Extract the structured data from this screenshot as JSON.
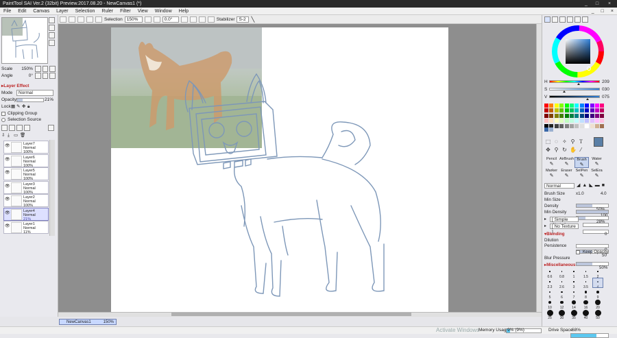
{
  "title": "PaintTool SAI Ver.2 (32bit) Preview.2017.08.20 - NewCanvas1 (*)",
  "window_buttons": [
    "_",
    "□",
    "×"
  ],
  "menu": [
    "File",
    "Edit",
    "Canvas",
    "Layer",
    "Selection",
    "Ruler",
    "Filter",
    "View",
    "Window",
    "Help"
  ],
  "menu_right": [
    "_",
    "□",
    "×"
  ],
  "toolbar": {
    "selection_label": "Selection",
    "zoom": "150%",
    "angle": "0.0°",
    "stabilizer_label": "Stabilizer",
    "stabilizer_value": "S-2"
  },
  "navigator": {
    "scale_label": "Scale",
    "scale_value": "150%",
    "angle_label": "Angle",
    "angle_value": "0°"
  },
  "layer_panel": {
    "layer_effect": "Layer Effect",
    "mode_label": "Mode",
    "mode_value": "Normal",
    "opacity_label": "Opacity",
    "opacity_value": "21%",
    "opacity_level": 0.21,
    "lock_label": "Lock",
    "clipping_group": "Clipping Group",
    "selection_source": "Selection Source",
    "layers": [
      {
        "name": "Layer7",
        "mode": "Normal",
        "opacity": "100%",
        "selected": false
      },
      {
        "name": "Layer6",
        "mode": "Normal",
        "opacity": "100%",
        "selected": false
      },
      {
        "name": "Layer5",
        "mode": "Normal",
        "opacity": "100%",
        "selected": false
      },
      {
        "name": "Layer3",
        "mode": "Normal",
        "opacity": "100%",
        "selected": false
      },
      {
        "name": "Layer2",
        "mode": "Normal",
        "opacity": "100%",
        "selected": false
      },
      {
        "name": "Layer4",
        "mode": "Normal",
        "opacity": "21%",
        "selected": true
      },
      {
        "name": "Layer1",
        "mode": "Normal",
        "opacity": "11%",
        "selected": false
      }
    ]
  },
  "canvas_tab": {
    "name": "NewCanvas1",
    "zoom": "150%"
  },
  "status": {
    "memory_label": "Memory Usage",
    "memory_value": "9% (9%)",
    "memory_level": 0.09,
    "drive_label": "Drive Space",
    "drive_value": "68%",
    "drive_level": 0.68,
    "watermark": "Activate Windows"
  },
  "color": {
    "h_label": "H",
    "h_value": "209",
    "h_level": 0.58,
    "s_label": "S",
    "s_value": "030",
    "s_level": 0.3,
    "v_label": "V",
    "v_value": "075",
    "v_level": 0.75,
    "current": "#5a7fa6",
    "palette": [
      "#ff0000",
      "#ff8000",
      "#ffff00",
      "#80ff00",
      "#00ff00",
      "#00ff80",
      "#00ffff",
      "#0080ff",
      "#0000ff",
      "#8000ff",
      "#ff00ff",
      "#ff0080",
      "#c00000",
      "#c06000",
      "#c0c000",
      "#60c000",
      "#00c000",
      "#00c060",
      "#00c0c0",
      "#0060c0",
      "#0000c0",
      "#6000c0",
      "#c000c0",
      "#c00060",
      "#800000",
      "#804000",
      "#808000",
      "#408000",
      "#008000",
      "#008040",
      "#008080",
      "#004080",
      "#000080",
      "#400080",
      "#800080",
      "#800040",
      "#ffc0c0",
      "#ffe0c0",
      "#ffffc0",
      "#e0ffc0",
      "#c0ffc0",
      "#c0ffe0",
      "#c0ffff",
      "#c0e0ff",
      "#c0c0ff",
      "#e0c0ff",
      "#ffc0ff",
      "#ffc0e0",
      "#000000",
      "#202020",
      "#404040",
      "#606060",
      "#808080",
      "#a0a0a0",
      "#c0c0c0",
      "#e0e0e0",
      "#ffffff",
      "#f0e0d0",
      "#d0b090",
      "#a07050"
    ]
  },
  "tools": [
    {
      "label": "Pencil",
      "selected": false
    },
    {
      "label": "AirBrush",
      "selected": false
    },
    {
      "label": "Brush",
      "selected": true
    },
    {
      "label": "Water",
      "selected": false
    },
    {
      "label": "Marker",
      "selected": false
    },
    {
      "label": "Eraser",
      "selected": false
    },
    {
      "label": "SelPen",
      "selected": false
    },
    {
      "label": "SelEra",
      "selected": false
    }
  ],
  "tool_icons": [
    "rect-select-icon",
    "lasso-icon",
    "magic-wand-icon",
    "eyedropper-icon",
    "text-icon",
    "move-icon",
    "zoom-icon",
    "rotate-icon",
    "hand-icon",
    "dropper-icon"
  ],
  "text_tool_glyph": "T",
  "brush": {
    "blend_mode": "Normal",
    "size_label": "Brush Size",
    "size_mult": "x1.0",
    "size_value": "4.0",
    "min_size_label": "Min Size",
    "min_size_value": "50%",
    "density_label": "Density",
    "density_value": "100",
    "min_density_label": "Min Density",
    "min_density_value": "28%",
    "shape": "[ Simple Circle ]",
    "texture": "[ No Texture ]",
    "blending_header": "Blending",
    "blending_value": "0",
    "dilution_label": "Dilution",
    "dilution_value": "0",
    "persistence_label": "Persistence",
    "persistence_value": "50",
    "keep_opacity": "Keep Opacity",
    "blur_label": "Blur Pressure",
    "blur_value": "50%",
    "misc_header": "Miscellaneous"
  },
  "brush_sizes": [
    "0.6",
    "0.8",
    "1",
    "1.5",
    "2",
    "2.3",
    "2.6",
    "3",
    "3.5",
    "4",
    "5",
    "6",
    "7",
    "8",
    "9",
    "10",
    "12",
    "14",
    "16",
    "20",
    "25",
    "30",
    "35",
    "40",
    "50"
  ]
}
